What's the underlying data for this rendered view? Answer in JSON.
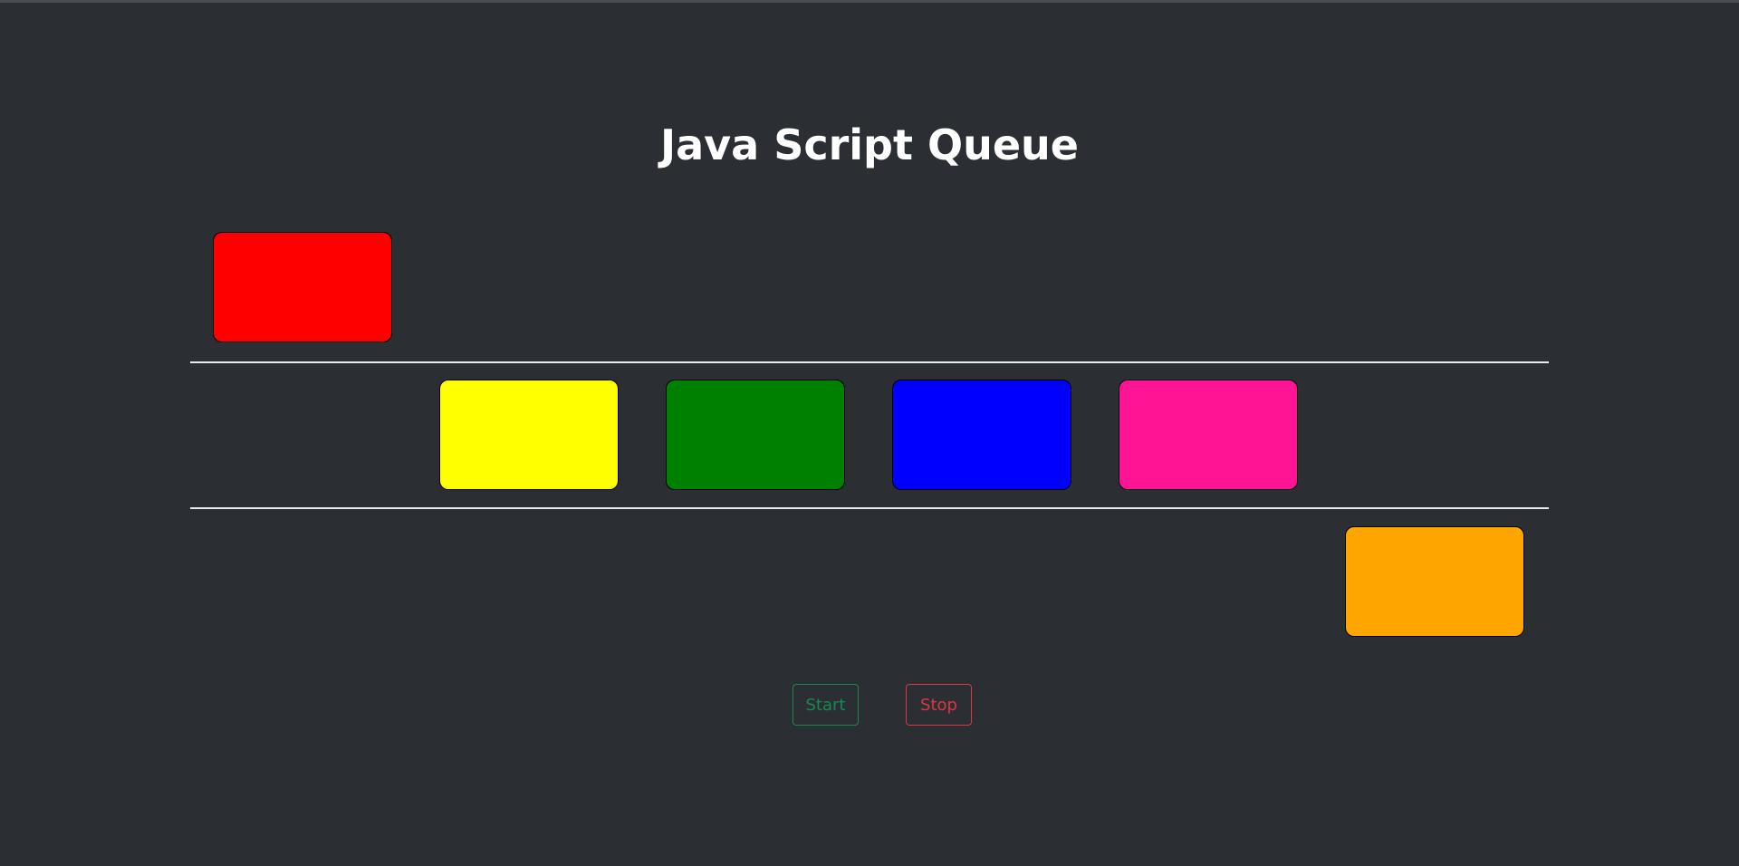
{
  "page": {
    "title": "Java Script Queue"
  },
  "queue": {
    "boxes": [
      {
        "name": "red",
        "color": "#ff0000",
        "lane": "above"
      },
      {
        "name": "yellow",
        "color": "#ffff00",
        "lane": "queue"
      },
      {
        "name": "green",
        "color": "#008000",
        "lane": "queue"
      },
      {
        "name": "blue",
        "color": "#0000ff",
        "lane": "queue"
      },
      {
        "name": "pink",
        "color": "#ff1493",
        "lane": "queue"
      },
      {
        "name": "orange",
        "color": "#ffa500",
        "lane": "below"
      }
    ]
  },
  "controls": {
    "start_label": "Start",
    "stop_label": "Stop"
  },
  "colors": {
    "background": "#2b2f34",
    "start_accent": "#198754",
    "stop_accent": "#dc3545"
  }
}
